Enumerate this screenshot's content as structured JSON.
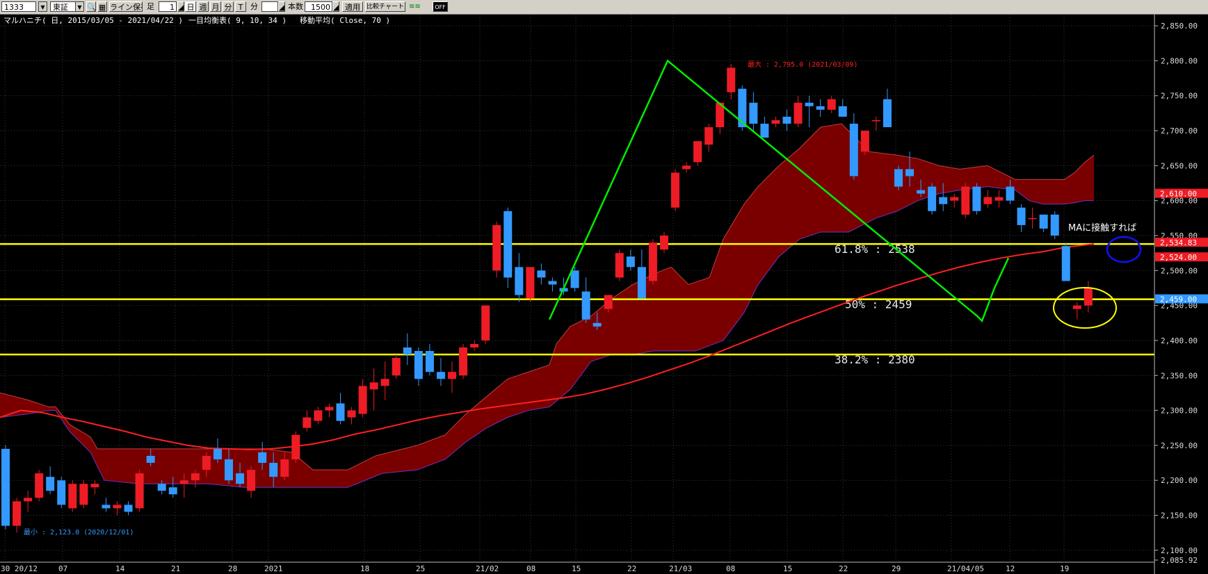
{
  "toolbar": {
    "code": "1333",
    "market": "東証",
    "line_save": "ライン保存",
    "foot_label": "足",
    "foot_value": "1",
    "unit_day": "日",
    "unit_week": "週",
    "unit_month": "月",
    "unit_minute": "分",
    "unit_tick": "T",
    "minute_label": "分",
    "count_label": "本数",
    "count_value": "1500",
    "apply": "適用",
    "compare": "比較チャート",
    "off": "OFF"
  },
  "header": {
    "title": "マルハニチ( 日, 2015/03/05 - 2021/04/22 )",
    "ichimoku": "一目均衡表( 9, 10, 34 )",
    "ma": "移動平均( Close, 70 )"
  },
  "colors": {
    "up": "#ee1c25",
    "down": "#3399ff",
    "ma": "#ff2020",
    "cloud_bull": "#7a0000",
    "cloud_bear": "#1a0e8c",
    "fib": "#ffff00",
    "trend": "#00ee00",
    "grid": "#3a3a3a"
  },
  "chart_data": {
    "type": "candlestick",
    "ylim": [
      2085.92,
      2866
    ],
    "y_ticks": [
      "2,850.00",
      "2,800.00",
      "2,750.00",
      "2,700.00",
      "2,650.00",
      "2,600.00",
      "2,550.00",
      "2,500.00",
      "2,450.00",
      "2,400.00",
      "2,350.00",
      "2,300.00",
      "2,250.00",
      "2,200.00",
      "2,150.00",
      "2,100.00",
      "2,085.92"
    ],
    "x_ticks": [
      "30 20/12",
      "07",
      "14",
      "21",
      "28",
      "2021",
      "18",
      "25",
      "21/02",
      "08",
      "15",
      "22",
      "21/03",
      "08",
      "15",
      "22",
      "29",
      "21/04/05",
      "12",
      "19"
    ],
    "candles": [
      [
        2245,
        2250,
        2130,
        2135
      ],
      [
        2135,
        2175,
        2125,
        2170
      ],
      [
        2170,
        2185,
        2155,
        2175
      ],
      [
        2175,
        2215,
        2170,
        2210
      ],
      [
        2205,
        2220,
        2180,
        2185
      ],
      [
        2200,
        2205,
        2160,
        2165
      ],
      [
        2160,
        2200,
        2155,
        2195
      ],
      [
        2165,
        2200,
        2160,
        2195
      ],
      [
        2190,
        2200,
        2180,
        2195
      ],
      [
        2165,
        2175,
        2155,
        2160
      ],
      [
        2160,
        2170,
        2150,
        2165
      ],
      [
        2165,
        2170,
        2150,
        2155
      ],
      [
        2160,
        2215,
        2155,
        2210
      ],
      [
        2235,
        2245,
        2220,
        2225
      ],
      [
        2195,
        2200,
        2180,
        2185
      ],
      [
        2190,
        2205,
        2175,
        2180
      ],
      [
        2195,
        2210,
        2175,
        2200
      ],
      [
        2200,
        2215,
        2190,
        2210
      ],
      [
        2215,
        2240,
        2205,
        2235
      ],
      [
        2245,
        2260,
        2225,
        2230
      ],
      [
        2230,
        2245,
        2195,
        2200
      ],
      [
        2210,
        2225,
        2190,
        2195
      ],
      [
        2185,
        2220,
        2175,
        2215
      ],
      [
        2240,
        2255,
        2215,
        2225
      ],
      [
        2225,
        2240,
        2190,
        2205
      ],
      [
        2205,
        2240,
        2200,
        2230
      ],
      [
        2230,
        2270,
        2225,
        2265
      ],
      [
        2275,
        2300,
        2270,
        2290
      ],
      [
        2285,
        2305,
        2280,
        2300
      ],
      [
        2300,
        2310,
        2290,
        2305
      ],
      [
        2310,
        2325,
        2280,
        2285
      ],
      [
        2290,
        2305,
        2280,
        2300
      ],
      [
        2295,
        2345,
        2290,
        2335
      ],
      [
        2330,
        2360,
        2300,
        2340
      ],
      [
        2335,
        2370,
        2315,
        2345
      ],
      [
        2350,
        2380,
        2345,
        2375
      ],
      [
        2390,
        2410,
        2365,
        2380
      ],
      [
        2385,
        2390,
        2335,
        2345
      ],
      [
        2385,
        2395,
        2350,
        2355
      ],
      [
        2355,
        2375,
        2335,
        2345
      ],
      [
        2345,
        2370,
        2325,
        2355
      ],
      [
        2350,
        2395,
        2345,
        2390
      ],
      [
        2390,
        2400,
        2385,
        2395
      ],
      [
        2400,
        2450,
        2395,
        2450
      ],
      [
        2500,
        2570,
        2490,
        2565
      ],
      [
        2585,
        2590,
        2475,
        2490
      ],
      [
        2505,
        2525,
        2455,
        2465
      ],
      [
        2460,
        2505,
        2455,
        2505
      ],
      [
        2500,
        2510,
        2480,
        2490
      ],
      [
        2485,
        2490,
        2470,
        2480
      ],
      [
        2475,
        2490,
        2465,
        2470
      ],
      [
        2500,
        2505,
        2470,
        2475
      ],
      [
        2470,
        2490,
        2425,
        2430
      ],
      [
        2425,
        2440,
        2415,
        2420
      ],
      [
        2445,
        2465,
        2440,
        2465
      ],
      [
        2490,
        2530,
        2485,
        2525
      ],
      [
        2520,
        2530,
        2500,
        2505
      ],
      [
        2505,
        2530,
        2460,
        2460
      ],
      [
        2485,
        2545,
        2480,
        2540
      ],
      [
        2530,
        2555,
        2525,
        2550
      ],
      [
        2590,
        2645,
        2585,
        2640
      ],
      [
        2645,
        2655,
        2640,
        2650
      ],
      [
        2655,
        2685,
        2650,
        2685
      ],
      [
        2680,
        2710,
        2670,
        2705
      ],
      [
        2705,
        2740,
        2695,
        2740
      ],
      [
        2755,
        2795,
        2745,
        2790
      ],
      [
        2760,
        2765,
        2700,
        2705
      ],
      [
        2740,
        2755,
        2700,
        2710
      ],
      [
        2710,
        2720,
        2690,
        2690
      ],
      [
        2710,
        2720,
        2705,
        2715
      ],
      [
        2720,
        2730,
        2700,
        2710
      ],
      [
        2710,
        2750,
        2705,
        2740
      ],
      [
        2740,
        2750,
        2705,
        2735
      ],
      [
        2735,
        2745,
        2720,
        2730
      ],
      [
        2730,
        2750,
        2725,
        2745
      ],
      [
        2735,
        2745,
        2720,
        2720
      ],
      [
        2710,
        2725,
        2630,
        2635
      ],
      [
        2670,
        2700,
        2665,
        2700
      ],
      [
        2715,
        2720,
        2700,
        2715
      ],
      [
        2745,
        2760,
        2705,
        2705
      ],
      [
        2645,
        2650,
        2615,
        2620
      ],
      [
        2645,
        2670,
        2620,
        2635
      ],
      [
        2615,
        2630,
        2605,
        2610
      ],
      [
        2620,
        2625,
        2580,
        2585
      ],
      [
        2605,
        2625,
        2585,
        2595
      ],
      [
        2600,
        2610,
        2590,
        2605
      ],
      [
        2580,
        2625,
        2575,
        2620
      ],
      [
        2620,
        2625,
        2580,
        2585
      ],
      [
        2595,
        2615,
        2590,
        2605
      ],
      [
        2600,
        2615,
        2590,
        2605
      ],
      [
        2620,
        2630,
        2595,
        2600
      ],
      [
        2590,
        2595,
        2555,
        2565
      ],
      [
        2575,
        2590,
        2560,
        2575
      ],
      [
        2580,
        2580,
        2555,
        2560
      ],
      [
        2580,
        2585,
        2545,
        2550
      ],
      [
        2535,
        2540,
        2485,
        2485
      ],
      [
        2445,
        2455,
        2430,
        2450
      ],
      [
        2450,
        2485,
        2440,
        2475
      ]
    ],
    "ma70": [
      [
        0,
        2290
      ],
      [
        30,
        2300
      ],
      [
        60,
        2297
      ],
      [
        90,
        2290
      ],
      [
        120,
        2284
      ],
      [
        150,
        2277
      ],
      [
        180,
        2270
      ],
      [
        210,
        2262
      ],
      [
        240,
        2256
      ],
      [
        270,
        2250
      ],
      [
        300,
        2246
      ],
      [
        330,
        2245
      ],
      [
        360,
        2244
      ],
      [
        390,
        2245
      ],
      [
        420,
        2248
      ],
      [
        450,
        2252
      ],
      [
        480,
        2258
      ],
      [
        510,
        2266
      ],
      [
        540,
        2272
      ],
      [
        570,
        2279
      ],
      [
        600,
        2286
      ],
      [
        630,
        2292
      ],
      [
        660,
        2297
      ],
      [
        690,
        2302
      ],
      [
        720,
        2306
      ],
      [
        750,
        2310
      ],
      [
        780,
        2314
      ],
      [
        810,
        2318
      ],
      [
        840,
        2323
      ],
      [
        870,
        2330
      ],
      [
        900,
        2338
      ],
      [
        930,
        2347
      ],
      [
        960,
        2357
      ],
      [
        990,
        2367
      ],
      [
        1020,
        2378
      ],
      [
        1050,
        2390
      ],
      [
        1080,
        2402
      ],
      [
        1110,
        2414
      ],
      [
        1140,
        2426
      ],
      [
        1170,
        2437
      ],
      [
        1200,
        2448
      ],
      [
        1230,
        2459
      ],
      [
        1260,
        2469
      ],
      [
        1290,
        2479
      ],
      [
        1320,
        2488
      ],
      [
        1350,
        2497
      ],
      [
        1380,
        2505
      ],
      [
        1410,
        2512
      ],
      [
        1440,
        2518
      ],
      [
        1470,
        2523
      ],
      [
        1500,
        2527
      ],
      [
        1530,
        2533
      ],
      [
        1573,
        2538
      ]
    ],
    "cloud_upper": [
      [
        0,
        2325
      ],
      [
        40,
        2315
      ],
      [
        70,
        2305
      ],
      [
        80,
        2305
      ],
      [
        100,
        2280
      ],
      [
        130,
        2262
      ],
      [
        140,
        2245
      ],
      [
        380,
        2245
      ],
      [
        420,
        2240
      ],
      [
        450,
        2215
      ],
      [
        500,
        2215
      ],
      [
        540,
        2235
      ],
      [
        600,
        2250
      ],
      [
        640,
        2265
      ],
      [
        670,
        2295
      ],
      [
        700,
        2320
      ],
      [
        730,
        2345
      ],
      [
        760,
        2355
      ],
      [
        790,
        2365
      ],
      [
        800,
        2395
      ],
      [
        820,
        2420
      ],
      [
        850,
        2435
      ],
      [
        880,
        2460
      ],
      [
        910,
        2480
      ],
      [
        940,
        2495
      ],
      [
        965,
        2505
      ],
      [
        990,
        2480
      ],
      [
        1020,
        2490
      ],
      [
        1040,
        2545
      ],
      [
        1070,
        2595
      ],
      [
        1090,
        2620
      ],
      [
        1120,
        2650
      ],
      [
        1150,
        2675
      ],
      [
        1180,
        2705
      ],
      [
        1210,
        2710
      ],
      [
        1250,
        2670
      ],
      [
        1290,
        2665
      ],
      [
        1320,
        2660
      ],
      [
        1350,
        2650
      ],
      [
        1380,
        2645
      ],
      [
        1420,
        2650
      ],
      [
        1460,
        2630
      ],
      [
        1500,
        2630
      ],
      [
        1530,
        2630
      ],
      [
        1545,
        2640
      ],
      [
        1560,
        2655
      ],
      [
        1573,
        2665
      ]
    ],
    "cloud_lower": [
      [
        0,
        2290
      ],
      [
        40,
        2295
      ],
      [
        70,
        2300
      ],
      [
        80,
        2300
      ],
      [
        100,
        2270
      ],
      [
        130,
        2240
      ],
      [
        150,
        2200
      ],
      [
        200,
        2195
      ],
      [
        300,
        2195
      ],
      [
        350,
        2190
      ],
      [
        400,
        2190
      ],
      [
        440,
        2190
      ],
      [
        500,
        2190
      ],
      [
        550,
        2210
      ],
      [
        600,
        2215
      ],
      [
        640,
        2230
      ],
      [
        670,
        2255
      ],
      [
        700,
        2275
      ],
      [
        730,
        2290
      ],
      [
        760,
        2300
      ],
      [
        790,
        2305
      ],
      [
        820,
        2330
      ],
      [
        850,
        2370
      ],
      [
        880,
        2380
      ],
      [
        910,
        2380
      ],
      [
        940,
        2385
      ],
      [
        970,
        2385
      ],
      [
        1000,
        2385
      ],
      [
        1040,
        2400
      ],
      [
        1070,
        2440
      ],
      [
        1090,
        2480
      ],
      [
        1120,
        2520
      ],
      [
        1150,
        2545
      ],
      [
        1180,
        2555
      ],
      [
        1220,
        2555
      ],
      [
        1260,
        2575
      ],
      [
        1290,
        2585
      ],
      [
        1320,
        2600
      ],
      [
        1350,
        2610
      ],
      [
        1380,
        2615
      ],
      [
        1420,
        2620
      ],
      [
        1460,
        2615
      ],
      [
        1480,
        2600
      ],
      [
        1500,
        2595
      ],
      [
        1530,
        2595
      ],
      [
        1545,
        2597
      ],
      [
        1560,
        2600
      ],
      [
        1573,
        2600
      ]
    ],
    "fib_levels": [
      {
        "label": "61.8% : 2538",
        "value": 2538
      },
      {
        "label": "50% : 2459",
        "value": 2459
      },
      {
        "label": "38.2% : 2380",
        "value": 2380
      }
    ],
    "annotations": {
      "max_label": "最大 : 2,795.0 (2021/03/09)",
      "min_label": "最小 : 2,123.0 (2020/12/01)",
      "note": "MAに接触すれば",
      "price_tags": [
        "2,610.00",
        "2,534.83",
        "2,524.00",
        "2,459.00"
      ]
    },
    "trend_points": [
      [
        790,
        2430
      ],
      [
        960,
        2800
      ],
      [
        1405,
        2435
      ],
      [
        1412,
        2428
      ],
      [
        1430,
        2475
      ],
      [
        1450,
        2518
      ]
    ],
    "xlabel": "",
    "ylabel": ""
  }
}
